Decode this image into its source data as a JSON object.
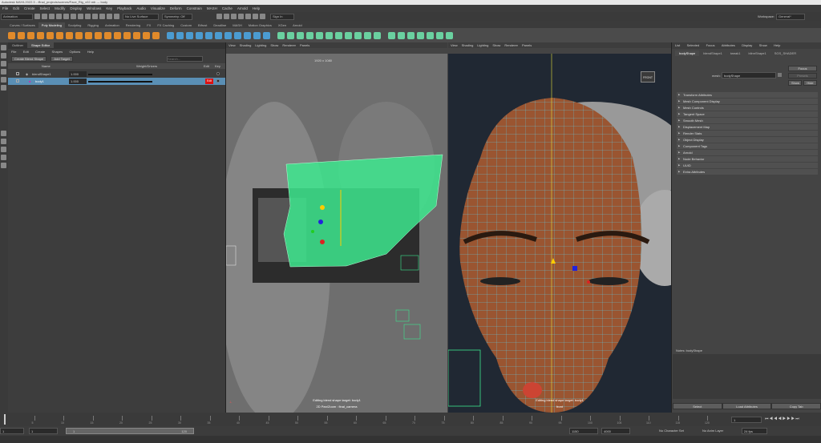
{
  "title_bar": "Autodesk MAYA 2022.3 - /final_projects/scenes/Face_Rig_v02.mb  ---  body",
  "menubar": [
    "File",
    "Edit",
    "Create",
    "Select",
    "Modify",
    "Display",
    "Windows",
    "Key",
    "Playback",
    "Audio",
    "Visualize",
    "Deform",
    "Constrain",
    "MASH",
    "Cache",
    "Arnold",
    "Help"
  ],
  "status_line": {
    "mode": "Animation",
    "live_surface": "No Live Surface",
    "symmetry": "Symmetry: Off",
    "signin": "Sign In",
    "workspace_label": "Workspace:",
    "workspace_value": "General*"
  },
  "shelf_tabs": [
    "Curves / Surfaces",
    "Poly Modeling",
    "Sculpting",
    "Rigging",
    "Animation",
    "Rendering",
    "FX",
    "FX Caching",
    "Custom",
    "Bifrost",
    "Deadline",
    "MASH",
    "Motion Graphics",
    "XGen",
    "Arnold"
  ],
  "shelf_active_tab": "Poly Modeling",
  "outliner": {
    "tabs": [
      "Outliner",
      "Shape Editor"
    ],
    "menus": [
      "File",
      "Edit",
      "Create",
      "Shapes",
      "Options",
      "Help"
    ],
    "create_btn": "Create Blend Shape",
    "add_btn": "Add Target",
    "search_placeholder": "Search...",
    "col_name": "Name",
    "col_weight": "Weight/Drivers",
    "col_edit": "Edit",
    "col_key": "Key",
    "rows": [
      {
        "name": "blendShape1",
        "value": "1.000",
        "edit": ""
      },
      {
        "name": "body1",
        "value": "1.000",
        "edit": "Edit"
      }
    ]
  },
  "viewport_menu": [
    "View",
    "Shading",
    "Lighting",
    "Show",
    "Renderer",
    "Panels"
  ],
  "vp1": {
    "resolution": "1920 x 1080",
    "hud_line1": "Editing blend shape target: body1",
    "hud_line2": "2D Pan/Zoom : final_camera"
  },
  "vp2": {
    "hud_line1": "Editing blend shape target: body1",
    "hud_line2": "front",
    "cube_label": "FRONT"
  },
  "attr_editor": {
    "menus": [
      "List",
      "Selected",
      "Focus",
      "Attributes",
      "Display",
      "Show",
      "Help"
    ],
    "tabs": [
      "bodyShape",
      "blendShape1",
      "tweak1",
      "blinnShape1",
      "SGS_SHADER"
    ],
    "mesh_label": "mesh:",
    "mesh_value": "bodyShape",
    "focus_btn": "Focus",
    "presets_btn": "Presets",
    "show_btn": "Show",
    "hide_btn": "Hide",
    "sections": [
      "Transform Attributes",
      "Mesh Component Display",
      "Mesh Controls",
      "Tangent Space",
      "Smooth Mesh",
      "Displacement Map",
      "Render Stats",
      "Object Display",
      "Component Tags",
      "Arnold",
      "Node Behavior",
      "UUID",
      "Extra Attributes"
    ],
    "notes_label": "Notes: bodyShape",
    "bottom_buttons": [
      "Select",
      "Load Attributes",
      "Copy Tab"
    ]
  },
  "timeline": {
    "ticks": [
      "5",
      "10",
      "15",
      "20",
      "25",
      "30",
      "35",
      "40",
      "45",
      "50",
      "55",
      "60",
      "65",
      "70",
      "75",
      "80",
      "85",
      "90",
      "95",
      "100",
      "105",
      "110",
      "115",
      "120"
    ],
    "current_frame": "1"
  },
  "range": {
    "start": "1",
    "inner_start": "1",
    "inner_end": "120",
    "playback_start": "1150",
    "end": "1150",
    "anim_end": "4000",
    "fps": "24 fps",
    "char_set": "No Character Set",
    "anim_layer": "No Anim Layer"
  },
  "colors": {
    "selected_row": "#5a8fb5",
    "edit_red": "#d11",
    "wireframe_green": "#3de88e",
    "mesh_wire": "#5bd1f0",
    "skin": "#9a5531"
  }
}
